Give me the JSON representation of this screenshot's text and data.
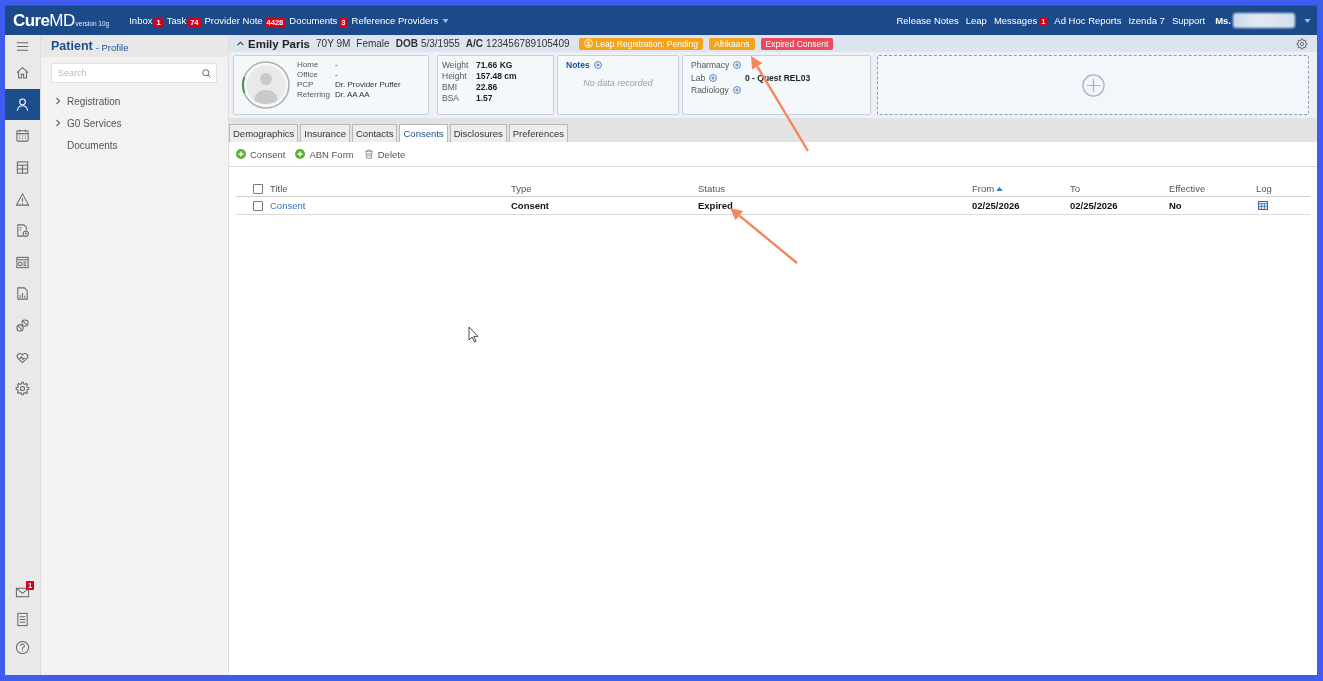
{
  "top_bar": {
    "logo": "**Cure**MD",
    "logo_version": "version 10g",
    "nav_left": [
      {
        "label": "Inbox",
        "badge": "1"
      },
      {
        "label": "Task",
        "badge": "74"
      },
      {
        "label": "Provider Note",
        "badge": "4428"
      },
      {
        "label": "Documents",
        "badge": "3"
      },
      {
        "label": "Reference Providers",
        "dropdown": true
      }
    ],
    "nav_right": [
      {
        "label": "Release Notes"
      },
      {
        "label": "Leap"
      },
      {
        "label": "Messages",
        "badge": "1"
      },
      {
        "label": "Ad Hoc Reports"
      },
      {
        "label": "Izenda 7"
      },
      {
        "label": "Support"
      }
    ],
    "user": {
      "label": "Ms.",
      "dropdown": true
    }
  },
  "icon_rail": {
    "top": [
      {
        "selected": false
      },
      {
        "selected": false
      },
      {
        "selected": true
      },
      {
        "selected": false
      },
      {
        "selected": false
      },
      {
        "selected": false
      },
      {
        "selected": false
      },
      {
        "selected": false
      },
      {
        "selected": false
      },
      {
        "selected": false
      },
      {
        "selected": false
      },
      {
        "selected": false
      }
    ],
    "bottom": [
      {
        "selected": false,
        "badge": "1"
      },
      {
        "selected": false
      },
      {
        "selected": false
      }
    ]
  },
  "sidebar": {
    "title": "Patient",
    "subtitle": "- Profile",
    "search": {
      "placeholder": "Search"
    },
    "items": [
      {
        "label": "Registration",
        "expandable": true,
        "expanded": false
      },
      {
        "label": "G0 Services",
        "expandable": true,
        "expanded": false
      },
      {
        "label": "Documents",
        "expandable": false
      }
    ]
  },
  "patient_header": {
    "expanded": true,
    "name": "Emily Paris",
    "age": "70Y 9M",
    "sex": "Female",
    "dob_label": "DOB",
    "dob": "5/3/1955",
    "account_label": "A/C",
    "account": "123456789105409",
    "badges": [
      {
        "label": "Leap Registration: Pending",
        "color": "#f5a31a",
        "has_icon": true
      },
      {
        "label": "Afrikaans",
        "color": "#f5a31a",
        "has_icon": false
      },
      {
        "label": "Expired Consent",
        "color": "#e84a5f",
        "has_icon": false
      }
    ]
  },
  "summary_cards": {
    "contact": {
      "fields": [
        {
          "label": "Home",
          "value": "-"
        },
        {
          "label": "Office",
          "value": "-"
        },
        {
          "label": "PCP",
          "value": "Dr. Provider Puffer"
        },
        {
          "label": "Referring",
          "value": "Dr. AA AA"
        }
      ]
    },
    "vitals": {
      "fields": [
        {
          "label": "Weight",
          "value": "71.66 KG"
        },
        {
          "label": "Height",
          "value": "157.48 cm"
        },
        {
          "label": "BMI",
          "value": "22.86"
        },
        {
          "label": "BSA",
          "value": "1.57"
        }
      ]
    },
    "notes": {
      "title": "Notes",
      "empty_text": "No data recorded"
    },
    "services": {
      "items": [
        {
          "label": "Pharmacy"
        },
        {
          "label": "Lab",
          "value": "0 - Quest REL03"
        },
        {
          "label": "Radiology"
        }
      ]
    }
  },
  "tabs": [
    {
      "label": "Demographics",
      "selected": false
    },
    {
      "label": "Insurance",
      "selected": false
    },
    {
      "label": "Contacts",
      "selected": false
    },
    {
      "label": "Consents",
      "selected": true
    },
    {
      "label": "Disclosures",
      "selected": false
    },
    {
      "label": "Preferences",
      "selected": false
    }
  ],
  "toolbar": [
    {
      "label": "Consent",
      "kind": "add"
    },
    {
      "label": "ABN Form",
      "kind": "add"
    },
    {
      "label": "Delete",
      "kind": "delete"
    }
  ],
  "table": {
    "select_all": {
      "checked": false
    },
    "columns": [
      {
        "label": "Title",
        "sorted": false
      },
      {
        "label": "Type",
        "sorted": false
      },
      {
        "label": "Status",
        "sorted": false
      },
      {
        "label": "From",
        "sorted": true
      },
      {
        "label": "To",
        "sorted": false
      },
      {
        "label": "Effective",
        "sorted": false
      },
      {
        "label": "Log",
        "sorted": false
      }
    ],
    "rows": [
      {
        "checked": false,
        "cells": [
          "Consent",
          "Consent",
          "Expired",
          "02/25/2026",
          "02/25/2026",
          "No"
        ]
      }
    ]
  }
}
